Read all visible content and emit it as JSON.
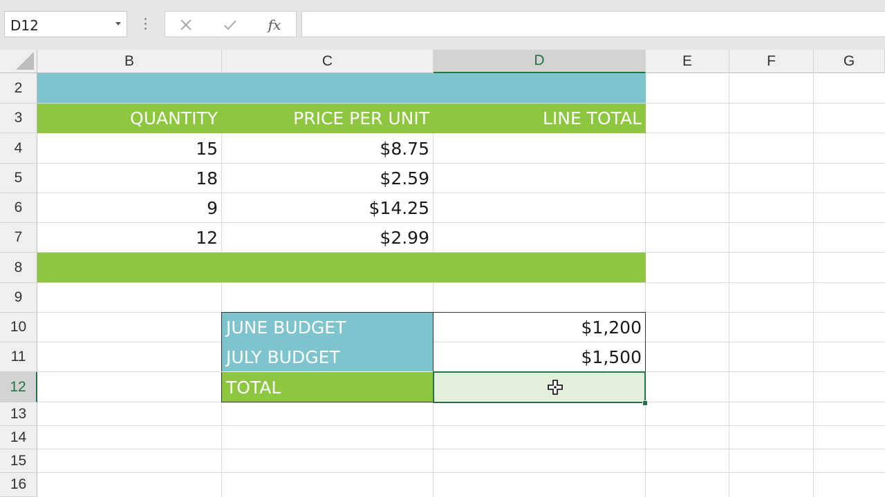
{
  "formula_bar": {
    "name_box": "D12",
    "cancel_icon": "x-icon",
    "enter_icon": "check-icon",
    "fx_label": "fx",
    "formula_value": ""
  },
  "columns": [
    "B",
    "C",
    "D",
    "E",
    "F",
    "G"
  ],
  "selected_column": "D",
  "rows": [
    "2",
    "3",
    "4",
    "5",
    "6",
    "7",
    "8",
    "9",
    "10",
    "11",
    "12",
    "13",
    "14",
    "15",
    "16"
  ],
  "selected_row": "12",
  "header_row": {
    "quantity": "QUANTITY",
    "price": "PRICE PER UNIT",
    "line_total": "LINE TOTAL"
  },
  "items": [
    {
      "quantity": "15",
      "price": "$8.75",
      "line_total": ""
    },
    {
      "quantity": "18",
      "price": "$2.59",
      "line_total": ""
    },
    {
      "quantity": "9",
      "price": "$14.25",
      "line_total": ""
    },
    {
      "quantity": "12",
      "price": "$2.99",
      "line_total": ""
    }
  ],
  "budget": {
    "june_label": "JUNE BUDGET",
    "june_value": "$1,200",
    "july_label": "JULY BUDGET",
    "july_value": "$1,500",
    "total_label": "TOTAL",
    "total_value": ""
  },
  "colors": {
    "teal": "#7ec4cf",
    "green": "#8dc63f",
    "selection": "#217346",
    "selection_fill": "#e2efda"
  }
}
